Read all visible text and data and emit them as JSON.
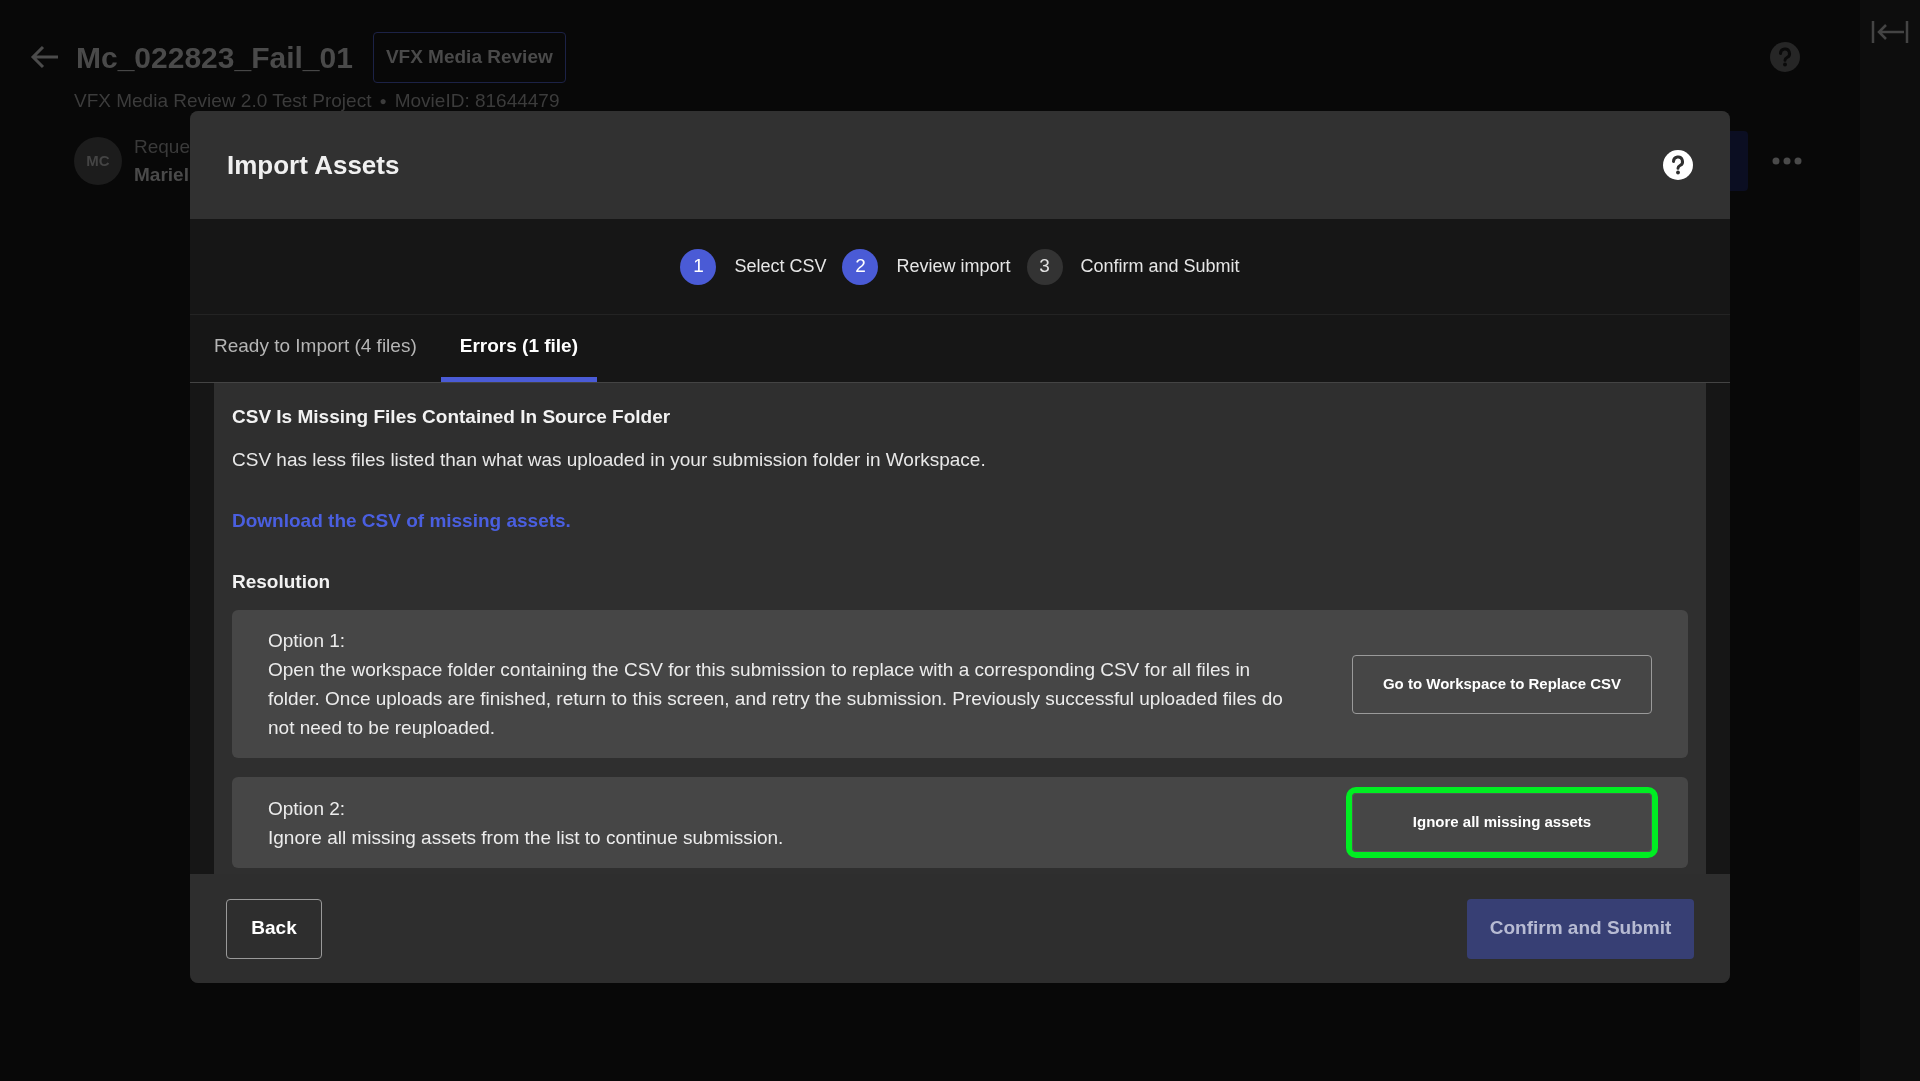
{
  "page": {
    "title": "Mc_022823_Fail_01",
    "badge": "VFX Media Review",
    "subtitle": "VFX Media Review 2.0 Test Project",
    "separator": "●",
    "movie_id": "MovieID: 81644479",
    "avatar": "MC",
    "requester_label": "Reque",
    "requester_name": "Mariel"
  },
  "dialog": {
    "title": "Import Assets",
    "steps": [
      {
        "number": "1",
        "label": "Select CSV",
        "active": true
      },
      {
        "number": "2",
        "label": "Review import",
        "active": true
      },
      {
        "number": "3",
        "label": "Confirm and Submit",
        "active": false
      }
    ],
    "tabs": [
      {
        "label": "Ready to Import (4 files)",
        "selected": false
      },
      {
        "label": "Errors (1 file)",
        "selected": true
      }
    ],
    "error": {
      "heading": "CSV Is Missing Files Contained In Source Folder",
      "description": "CSV has less files listed than what was uploaded in your submission folder in Workspace.",
      "link": "Download the CSV of missing assets.",
      "resolution_heading": "Resolution",
      "options": [
        {
          "label": "Option 1:",
          "text": "Open the workspace folder containing the CSV for this submission to replace with a corresponding CSV for all files in folder. Once uploads are finished, return to this screen, and retry the submission. Previously successful uploaded files do not need to be reuploaded.",
          "button": "Go to Workspace to Replace CSV",
          "highlighted": false
        },
        {
          "label": "Option 2:",
          "text": "Ignore all missing assets from the list to continue submission.",
          "button": "Ignore all missing assets",
          "highlighted": true
        }
      ]
    },
    "back_button": "Back",
    "submit_button": {
      "label": "Confirm and Submit",
      "disabled": true
    }
  }
}
